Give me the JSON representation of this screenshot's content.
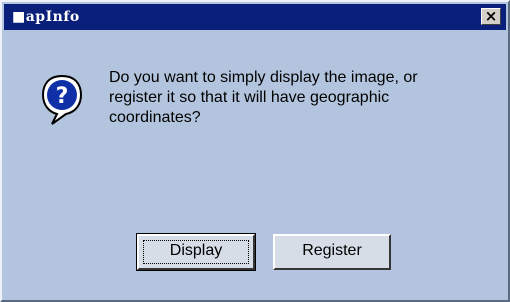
{
  "window": {
    "title": "■apInfo",
    "close_glyph": "×"
  },
  "dialog": {
    "icon": "question-icon",
    "message_lines": [
      "Do you want to simply display the image, or",
      "register it so that it will have geographic",
      "coordinates?"
    ]
  },
  "buttons": {
    "display_label": "Display",
    "register_label": "Register"
  },
  "colors": {
    "titlebar": "#0a1f7a",
    "dialog_bg": "#b3c5de",
    "icon_blue": "#1030a8"
  }
}
